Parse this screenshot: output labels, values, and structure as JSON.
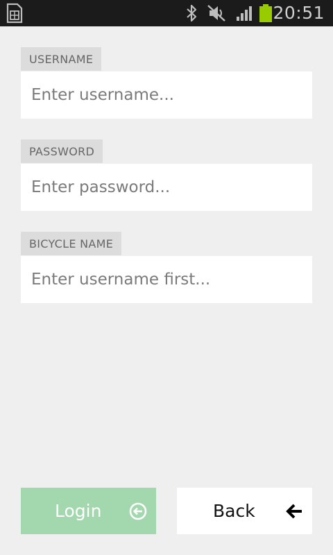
{
  "status_bar": {
    "time": "20:51",
    "icons": [
      "sim-card-icon",
      "bluetooth-icon",
      "mute-icon",
      "signal-icon",
      "battery-icon"
    ],
    "battery_color": "#99cc00"
  },
  "form": {
    "username": {
      "label": "USERNAME",
      "placeholder": "Enter username..."
    },
    "password": {
      "label": "PASSWORD",
      "placeholder": "Enter password..."
    },
    "bicycle": {
      "label": "BICYCLE NAME",
      "placeholder": "Enter username first..."
    }
  },
  "buttons": {
    "login": {
      "label": "Login",
      "icon": "login-circle-arrow-icon",
      "color": "#a3d7ad"
    },
    "back": {
      "label": "Back",
      "icon": "back-arrow-icon"
    }
  }
}
